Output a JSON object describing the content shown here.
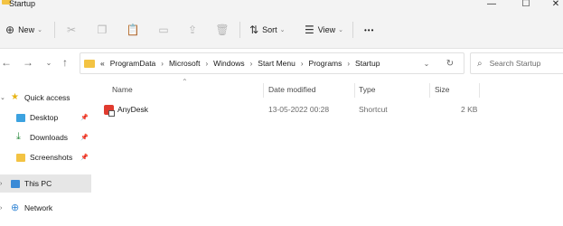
{
  "window": {
    "title": "Startup",
    "minimize_glyph": "—",
    "maximize_glyph": "☐",
    "close_glyph": "✕"
  },
  "commandbar": {
    "new_label": "New",
    "sort_label": "Sort",
    "view_label": "View",
    "more_glyph": "•••",
    "icons": [
      "cut-icon",
      "copy-icon",
      "paste-icon",
      "rename-icon",
      "share-icon",
      "delete-icon"
    ]
  },
  "address": {
    "overflow": "«",
    "crumbs": [
      "ProgramData",
      "Microsoft",
      "Windows",
      "Start Menu",
      "Programs",
      "Startup"
    ],
    "separator": "›"
  },
  "search": {
    "placeholder": "Search Startup"
  },
  "nav": {
    "items": [
      {
        "label": "Quick access",
        "icon": "star-icon"
      },
      {
        "label": "Desktop",
        "icon": "desktop-icon"
      },
      {
        "label": "Downloads",
        "icon": "download-icon"
      },
      {
        "label": "Screenshots",
        "icon": "folder-icon"
      },
      {
        "label": "This PC",
        "icon": "computer-icon"
      },
      {
        "label": "Network",
        "icon": "network-icon"
      }
    ]
  },
  "columns": {
    "name": "Name",
    "date": "Date modified",
    "type": "Type",
    "size": "Size"
  },
  "files": [
    {
      "name": "AnyDesk",
      "date": "13-05-2022 00:28",
      "type": "Shortcut",
      "size": "2 KB",
      "icon": "anydesk-icon"
    }
  ],
  "colors": {
    "folder": "#f3c343",
    "selected_nav": "#e6e6e6",
    "accent": "#0a64c8"
  }
}
